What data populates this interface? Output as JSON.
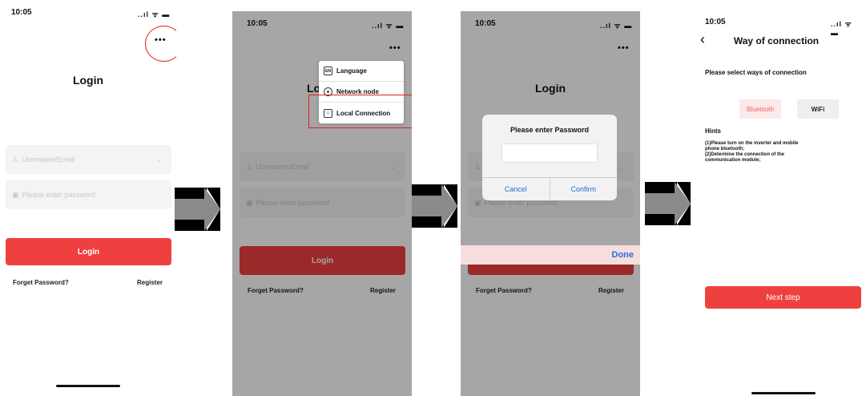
{
  "status_time": "10:05",
  "status_icons": "..ıl ᯤ ▬",
  "more_glyph": "•••",
  "login_screen": {
    "title": "Login",
    "username_placeholder": "Username/Email",
    "password_placeholder": "Please enter password",
    "login_button": "Login",
    "forget_password": "Forget Password?",
    "register": "Register"
  },
  "menu": {
    "items": [
      {
        "label": "Language",
        "icon": "language-icon",
        "glyph": "EN"
      },
      {
        "label": "Network node",
        "icon": "globe-icon",
        "glyph": "⊕"
      },
      {
        "label": "Local Connection",
        "icon": "local-connection-icon",
        "glyph": "▯"
      }
    ]
  },
  "password_dialog": {
    "title": "Please enter Password",
    "cancel": "Cancel",
    "confirm": "Confirm",
    "done": "Done"
  },
  "connection_screen": {
    "title": "Way of connection",
    "back_glyph": "‹",
    "subtitle": "Please select ways of connection",
    "options": [
      "Bluetooth",
      "WiFi"
    ],
    "selected_option": "Bluetooth",
    "hints_title": "Hints",
    "hints_text": "(1)Please turn on the inverter and mobile\nphone bluetooth;\n(2)Determine the connection of the\ncommunication module;",
    "next_button": "Next step"
  },
  "colors": {
    "accent_red": "#ef4040",
    "highlight": "#e02020",
    "ios_blue": "#2a6ad6"
  }
}
